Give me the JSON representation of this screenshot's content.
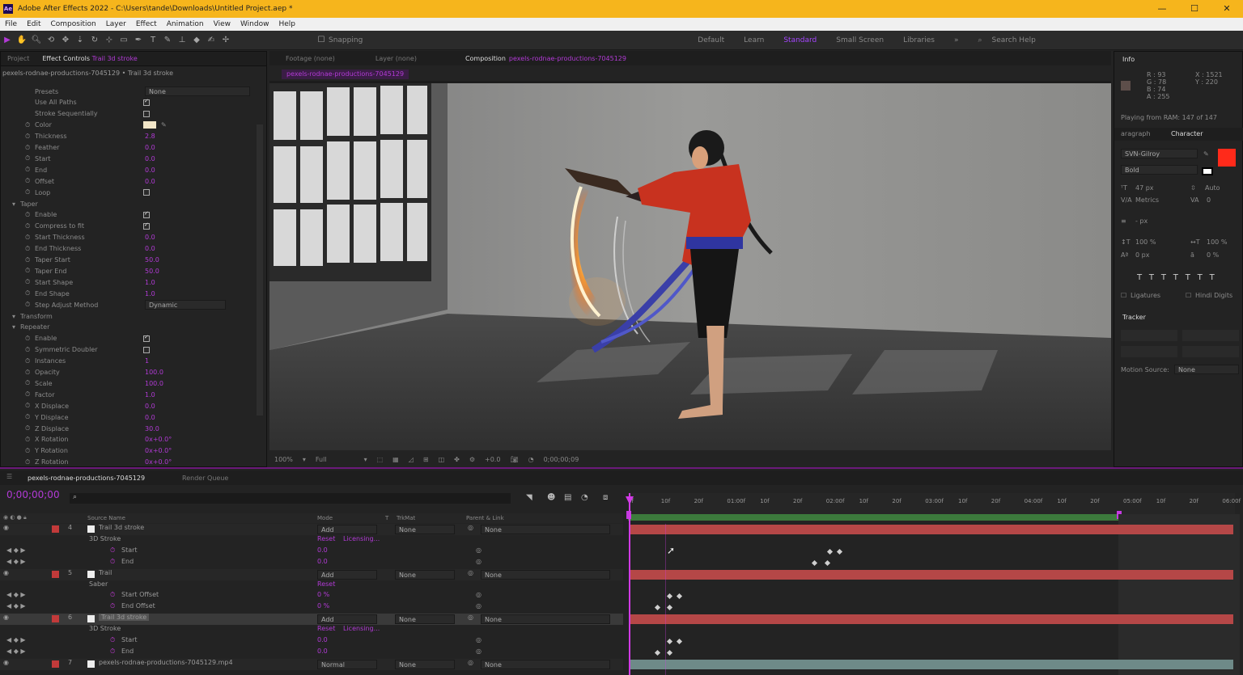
{
  "app": {
    "window_title": "Adobe After Effects 2022 - C:\\Users\\tande\\Downloads\\Untitled Project.aep *",
    "logo": "Ae"
  },
  "menu": [
    "File",
    "Edit",
    "Composition",
    "Layer",
    "Effect",
    "Animation",
    "View",
    "Window",
    "Help"
  ],
  "toolbar": {
    "snapping": "Snapping",
    "workspaces": [
      "Default",
      "Learn",
      "Standard",
      "Small Screen",
      "Libraries"
    ],
    "active_workspace": "Standard",
    "search": "Search Help"
  },
  "left_panel": {
    "tabs": [
      "Project",
      "Effect Controls"
    ],
    "effect_target": "Trail 3d stroke",
    "breadcrumb": "pexels-rodnae-productions-7045129 • Trail 3d stroke",
    "rows": [
      {
        "name": "Presets",
        "value": "None",
        "kind": "dropdown"
      },
      {
        "name": "Use All Paths",
        "kind": "check",
        "on": true
      },
      {
        "name": "Stroke Sequentially",
        "kind": "check",
        "on": false
      },
      {
        "name": "Color",
        "kind": "color"
      },
      {
        "name": "Thickness",
        "value": "2.8"
      },
      {
        "name": "Feather",
        "value": "0.0"
      },
      {
        "name": "Start",
        "value": "0.0"
      },
      {
        "name": "End",
        "value": "0.0"
      },
      {
        "name": "Offset",
        "value": "0.0"
      },
      {
        "name": "Loop",
        "kind": "check",
        "on": false
      },
      {
        "name": "Taper",
        "kind": "group"
      },
      {
        "name": "Enable",
        "kind": "check",
        "on": true
      },
      {
        "name": "Compress to fit",
        "kind": "check",
        "on": true
      },
      {
        "name": "Start Thickness",
        "value": "0.0"
      },
      {
        "name": "End Thickness",
        "value": "0.0"
      },
      {
        "name": "Taper Start",
        "value": "50.0"
      },
      {
        "name": "Taper End",
        "value": "50.0"
      },
      {
        "name": "Start Shape",
        "value": "1.0"
      },
      {
        "name": "End Shape",
        "value": "1.0"
      },
      {
        "name": "Step Adjust Method",
        "value": "Dynamic",
        "kind": "dropdown"
      },
      {
        "name": "Transform",
        "kind": "group"
      },
      {
        "name": "Repeater",
        "kind": "group"
      },
      {
        "name": "Enable",
        "kind": "check",
        "on": true
      },
      {
        "name": "Symmetric Doubler",
        "kind": "check",
        "on": false
      },
      {
        "name": "Instances",
        "value": "1"
      },
      {
        "name": "Opacity",
        "value": "100.0"
      },
      {
        "name": "Scale",
        "value": "100.0"
      },
      {
        "name": "Factor",
        "value": "1.0"
      },
      {
        "name": "X Displace",
        "value": "0.0"
      },
      {
        "name": "Y Displace",
        "value": "0.0"
      },
      {
        "name": "Z Displace",
        "value": "30.0"
      },
      {
        "name": "X Rotation",
        "value": "0x+0.0°"
      },
      {
        "name": "Y Rotation",
        "value": "0x+0.0°"
      },
      {
        "name": "Z Rotation",
        "value": "0x+0.0°"
      }
    ]
  },
  "center_tabs": {
    "footage": "Footage (none)",
    "layer": "Layer (none)",
    "composition": "Composition",
    "comp_name": "pexels-rodnae-productions-7045129"
  },
  "viewer_bar": {
    "zoom": "100%",
    "resolution": "Full",
    "exposure": "+0.0",
    "timecode": "0;00;00;09"
  },
  "right_panel": {
    "info": "Info",
    "rgb": {
      "r": "R : 93",
      "g": "G : 78",
      "b": "B : 74",
      "a": "A : 255"
    },
    "xy": {
      "x": "X : 1521",
      "y": "Y : 220"
    },
    "ram": "Playing from RAM: 147 of 147",
    "tabs": [
      "aragraph",
      "Character"
    ],
    "font": "SVN-Gilroy",
    "style": "Bold",
    "char_color": "#ff2a1a",
    "font_size": "47 px",
    "leading": "Auto",
    "tracking": "Metrics",
    "kerning": "0",
    "stroke_w": "- px",
    "vscale": "100 %",
    "hscale": "100 %",
    "baseline": "0 px",
    "tsume": "0 %",
    "ligatures": "Ligatures",
    "hindi": "Hindi Digits",
    "tracker": "Tracker",
    "motion_source": "Motion Source:",
    "motion_source_val": "None"
  },
  "timeline": {
    "tabs": [
      "pexels-rodnae-productions-7045129",
      "Render Queue"
    ],
    "timecode": "0;00;00;00",
    "columns": {
      "source": "Source Name",
      "mode": "Mode",
      "t": "T",
      "trkmat": "TrkMat",
      "parent": "Parent & Link"
    },
    "ruler": [
      "0f",
      "10f",
      "20f",
      "01:00f",
      "10f",
      "20f",
      "02:00f",
      "10f",
      "20f",
      "03:00f",
      "10f",
      "20f",
      "04:00f",
      "10f",
      "20f",
      "05:00f",
      "10f",
      "20f",
      "06:00f"
    ],
    "layers": [
      {
        "num": "4",
        "name": "Trail 3d stroke",
        "mode": "Add",
        "trk": "None",
        "parent": "None"
      },
      {
        "name": "3D Stroke",
        "reset": "Reset",
        "extra": "Licensing..."
      },
      {
        "name": "Start",
        "val": "0.0"
      },
      {
        "name": "End",
        "val": "0.0"
      },
      {
        "num": "5",
        "name": "Trail",
        "mode": "Add",
        "trk": "None",
        "parent": "None"
      },
      {
        "name": "Saber",
        "reset": "Reset"
      },
      {
        "name": "Start Offset",
        "val": "0 %"
      },
      {
        "name": "End Offset",
        "val": "0 %"
      },
      {
        "num": "6",
        "name": "Trail 3d stroke",
        "mode": "Add",
        "trk": "None",
        "parent": "None"
      },
      {
        "name": "3D Stroke",
        "reset": "Reset",
        "extra": "Licensing..."
      },
      {
        "name": "Start",
        "val": "0.0"
      },
      {
        "name": "End",
        "val": "0.0"
      },
      {
        "num": "7",
        "name": "pexels-rodnae-productions-7045129.mp4",
        "mode": "Normal",
        "trk": "None",
        "parent": "None"
      }
    ],
    "footer": "Toggle Switches / Modes",
    "render_time": "Frame Render Time"
  }
}
